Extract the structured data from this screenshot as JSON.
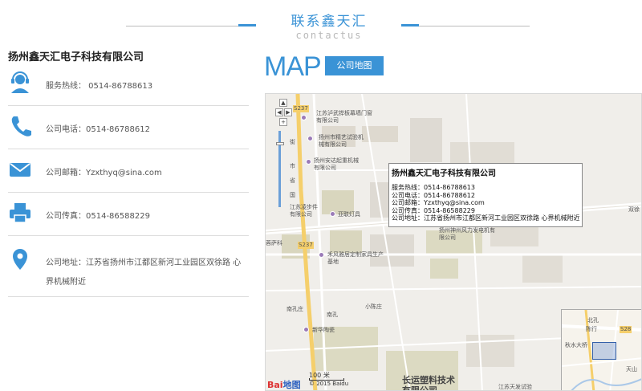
{
  "header": {
    "title": "联系鑫天汇",
    "subtitle": "contactus"
  },
  "company_name": "扬州鑫天汇电子科技有限公司",
  "contacts": [
    {
      "icon": "headset-icon",
      "text": "服务热线：  0514-86788613"
    },
    {
      "icon": "phone-icon",
      "text": "公司电话：0514-86788612"
    },
    {
      "icon": "mail-icon",
      "text": "公司邮箱：Yzxthyq@sina.com"
    },
    {
      "icon": "fax-icon",
      "text": "公司传真：0514-86588229"
    },
    {
      "icon": "location-pin-icon",
      "text": "公司地址：江苏省扬州市江都区新河工业园区双徐路 心界机械附近"
    }
  ],
  "map_section": {
    "heading": "MAP",
    "tag": "公司地图"
  },
  "map": {
    "popup": {
      "title": "扬州鑫天汇电子科技有限公司",
      "lines": [
        "服务热线：0514-86788613",
        "公司电话：0514-86788612",
        "公司邮箱：Yzxthyq@sina.com",
        "公司传真：0514-86588229",
        "公司地址：江苏省扬州市江都区新河工业园区双徐路 心界机械附近"
      ]
    },
    "labels": {
      "poi1": "江苏泸武铧板幕墙门窗有限公司",
      "poi2": "扬州市精艺试验机械有限公司",
      "poi3": "扬州安达起重机械有限公司",
      "poi4": "江苏凌步件有限公司",
      "poi5": "亚联灯具",
      "poi6": "扬州神州风力发电机有限公司",
      "poi7": "禾风雅居定制家具生产基地",
      "poi8": "南孔庄",
      "poi9": "南孔",
      "poi10": "小陈庄",
      "poi11": "新华陶瓷",
      "poi12": "长运塑料技术有限公司",
      "poi13": "江苏天发试验",
      "poi14": "双徐",
      "poi15": "蓉萨科",
      "road1": "S237",
      "road2": "S237",
      "mini1": "北孔",
      "mini2": "陈行",
      "mini3": "S28",
      "mini4": "天山",
      "mini5": "秋水大桥",
      "pan1": "街",
      "pan2": "市",
      "pan3": "省",
      "pan4": "国"
    },
    "scale": "100 米",
    "copyright": "© 2015 Baidu",
    "logo_a": "Bai",
    "logo_b": "地图"
  }
}
